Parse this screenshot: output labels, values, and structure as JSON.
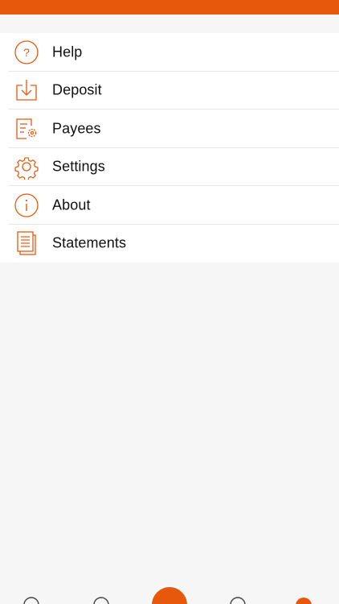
{
  "theme": {
    "accent": "#e8580c",
    "background": "#f6f6f6",
    "row": "#ffffff"
  },
  "menu": {
    "items": [
      {
        "label": "Help",
        "icon": "help-circle-icon"
      },
      {
        "label": "Deposit",
        "icon": "deposit-download-icon"
      },
      {
        "label": "Payees",
        "icon": "payees-document-gear-icon"
      },
      {
        "label": "Settings",
        "icon": "gear-icon"
      },
      {
        "label": "About",
        "icon": "info-circle-icon"
      },
      {
        "label": "Statements",
        "icon": "statements-pages-icon"
      }
    ]
  },
  "tab_bar": {
    "items": [
      {
        "icon": "tab-icon-1"
      },
      {
        "icon": "tab-icon-2"
      },
      {
        "icon": "tab-center-action-icon"
      },
      {
        "icon": "tab-icon-4"
      },
      {
        "icon": "tab-icon-5"
      }
    ]
  }
}
